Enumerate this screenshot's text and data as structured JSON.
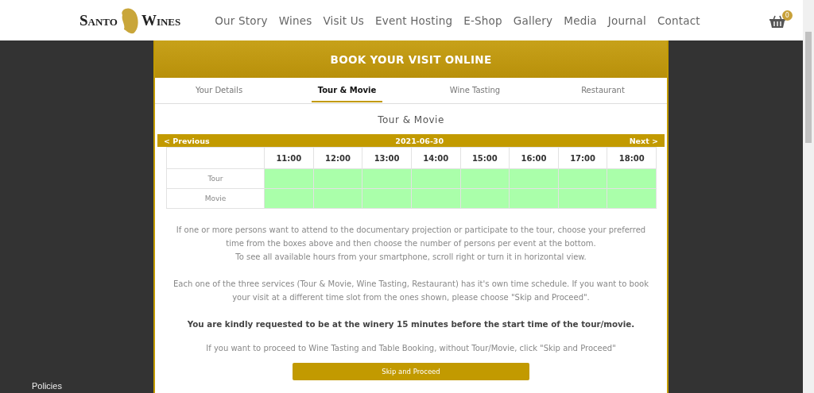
{
  "header": {
    "logo": {
      "left": "Santo",
      "right": "Wines"
    },
    "nav": [
      "Our Story",
      "Wines",
      "Visit Us",
      "Event Hosting",
      "E-Shop",
      "Gallery",
      "Media",
      "Journal",
      "Contact"
    ],
    "cart_count": "0"
  },
  "booking": {
    "title": "BOOK YOUR VISIT ONLINE",
    "tabs": [
      {
        "label": "Your Details",
        "selected": false
      },
      {
        "label": "Tour & Movie",
        "selected": true
      },
      {
        "label": "Wine Tasting",
        "selected": false
      },
      {
        "label": "Restaurant",
        "selected": false
      }
    ],
    "section_title": "Tour & Movie",
    "date_bar": {
      "previous": "< Previous",
      "date": "2021-06-30",
      "next": "Next >"
    },
    "times": [
      "11:00",
      "12:00",
      "13:00",
      "14:00",
      "15:00",
      "16:00",
      "17:00",
      "18:00"
    ],
    "rows": [
      {
        "label": "Tour",
        "slots": [
          {
            "available": true
          },
          {
            "available": true
          },
          {
            "available": true
          },
          {
            "available": true
          },
          {
            "available": true
          },
          {
            "available": true
          },
          {
            "available": true
          },
          {
            "available": true
          }
        ]
      },
      {
        "label": "Movie",
        "slots": [
          {
            "available": true
          },
          {
            "available": true
          },
          {
            "available": true
          },
          {
            "available": true
          },
          {
            "available": true
          },
          {
            "available": true
          },
          {
            "available": true
          },
          {
            "available": true
          }
        ]
      }
    ],
    "info": [
      "If one or more persons want to attend to the documentary projection or participate to the tour, choose your preferred time from the boxes above and then choose the number of persons per event at the bottom.",
      "To see all available hours from your smartphone, scroll right or turn it in horizontal view.",
      "Each one of the three services (Tour & Movie, Wine Tasting, Restaurant) has it's own time schedule. If you want to book your visit at a different time slot from the ones shown, please choose \"Skip and Proceed\"."
    ],
    "notice": "You are kindly requested to be at the winery 15 minutes before the start time of the tour/movie.",
    "skip_hint": "If you want to proceed to Wine Tasting and Table Booking, without Tour/Movie, click \"Skip and Proceed\"",
    "skip_button": "Skip and Proceed"
  },
  "footer": {
    "link": "Policies"
  }
}
